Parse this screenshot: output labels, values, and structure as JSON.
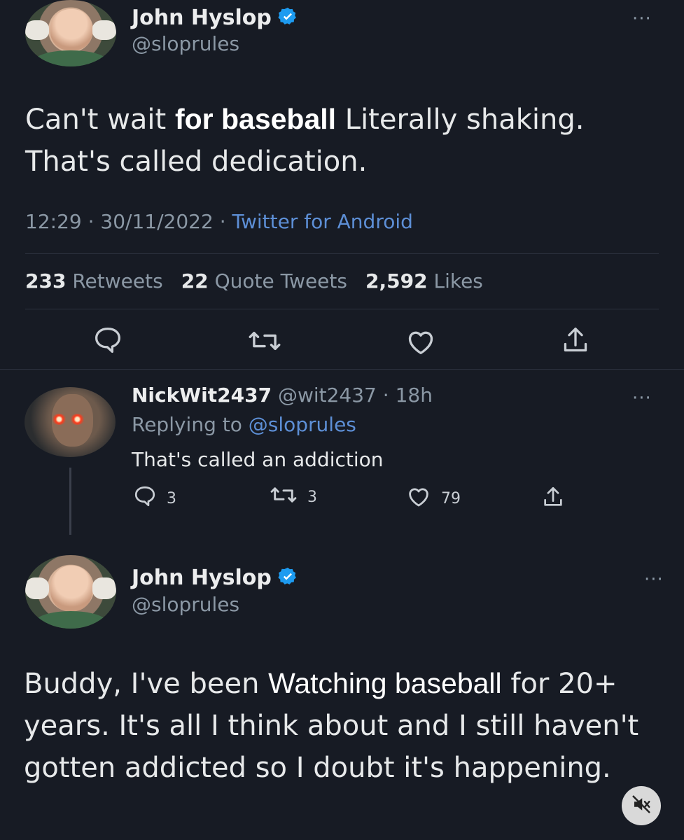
{
  "tweet": {
    "author_name": "John Hyslop",
    "author_handle": "@sloprules",
    "text_part1": "Can't wait ",
    "text_overlay": "for baseball",
    "text_part2": " Literally shaking. That's called dedication.",
    "time": "12:29",
    "date": "30/11/2022",
    "source": "Twitter for Android",
    "separator": " · ",
    "stats": {
      "retweets_count": "233",
      "retweets_label": "Retweets",
      "quotes_count": "22",
      "quotes_label": "Quote Tweets",
      "likes_count": "2,592",
      "likes_label": "Likes"
    },
    "more_label": "···"
  },
  "reply": {
    "author_name": "NickWit2437",
    "author_handle": "@wit2437",
    "time_ago": "18h",
    "meta_separator": " · ",
    "replying_prefix": "Replying to ",
    "replying_handle": "@sloprules",
    "text": "That's called an addiction",
    "reply_count": "3",
    "retweet_count": "3",
    "like_count": "79",
    "more_label": "···"
  },
  "response": {
    "author_name": "John Hyslop",
    "author_handle": "@sloprules",
    "text_part1": "Buddy, I've been ",
    "text_overlay": "Watching baseball",
    "text_part2": " for 20+ years. It's all I think about and I still haven't gotten addicted so I doubt it's happening.",
    "more_label": "···"
  },
  "icons": {
    "reply": "speech-bubble-icon",
    "retweet": "retweet-icon",
    "like": "heart-icon",
    "share": "share-icon",
    "verified": "verified-badge-icon",
    "mute": "muted-speaker-icon"
  },
  "colors": {
    "background": "#171b24",
    "text": "#e7e9ea",
    "secondary": "#8b98a5",
    "link": "#5d8fd6",
    "verified": "#1d9bf0"
  }
}
